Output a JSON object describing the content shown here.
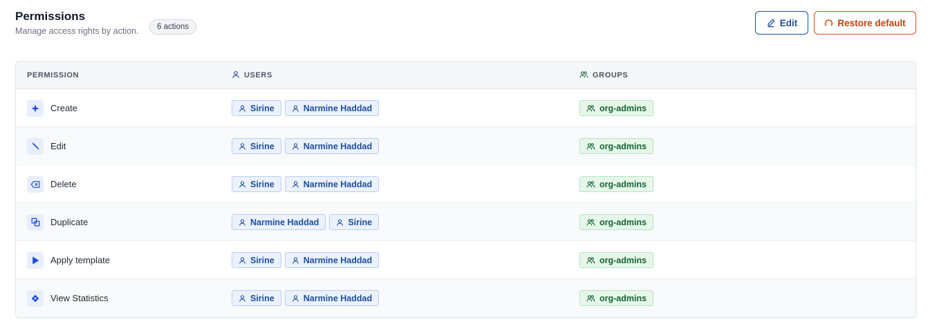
{
  "header": {
    "title": "Permissions",
    "subtitle": "Manage access rights by action.",
    "count_badge": "6 actions",
    "edit_label": "Edit",
    "restore_label": "Restore default"
  },
  "table": {
    "columns": [
      "PERMISSION",
      "USERS",
      "GROUPS"
    ],
    "rows": [
      {
        "permission": "Create",
        "icon": "sparkle-icon",
        "users": [
          "Sirine",
          "Narmine Haddad"
        ],
        "groups": [
          "org-admins"
        ]
      },
      {
        "permission": "Edit",
        "icon": "pencil-icon",
        "users": [
          "Sirine",
          "Narmine Haddad"
        ],
        "groups": [
          "org-admins"
        ]
      },
      {
        "permission": "Delete",
        "icon": "backspace-icon",
        "users": [
          "Sirine",
          "Narmine Haddad"
        ],
        "groups": [
          "org-admins"
        ]
      },
      {
        "permission": "Duplicate",
        "icon": "copy-icon",
        "users": [
          "Narmine Haddad",
          "Sirine"
        ],
        "groups": [
          "org-admins"
        ]
      },
      {
        "permission": "Apply template",
        "icon": "play-icon",
        "users": [
          "Sirine",
          "Narmine Haddad"
        ],
        "groups": [
          "org-admins"
        ]
      },
      {
        "permission": "View Statistics",
        "icon": "diamond-icon",
        "users": [
          "Sirine",
          "Narmine Haddad"
        ],
        "groups": [
          "org-admins"
        ]
      }
    ]
  },
  "colors": {
    "primary": "#1e4e9c",
    "danger": "#c2410c",
    "user_chip_bg": "#ebf2fd",
    "group_chip_bg": "#e6f7ea",
    "group_text": "#166534"
  }
}
